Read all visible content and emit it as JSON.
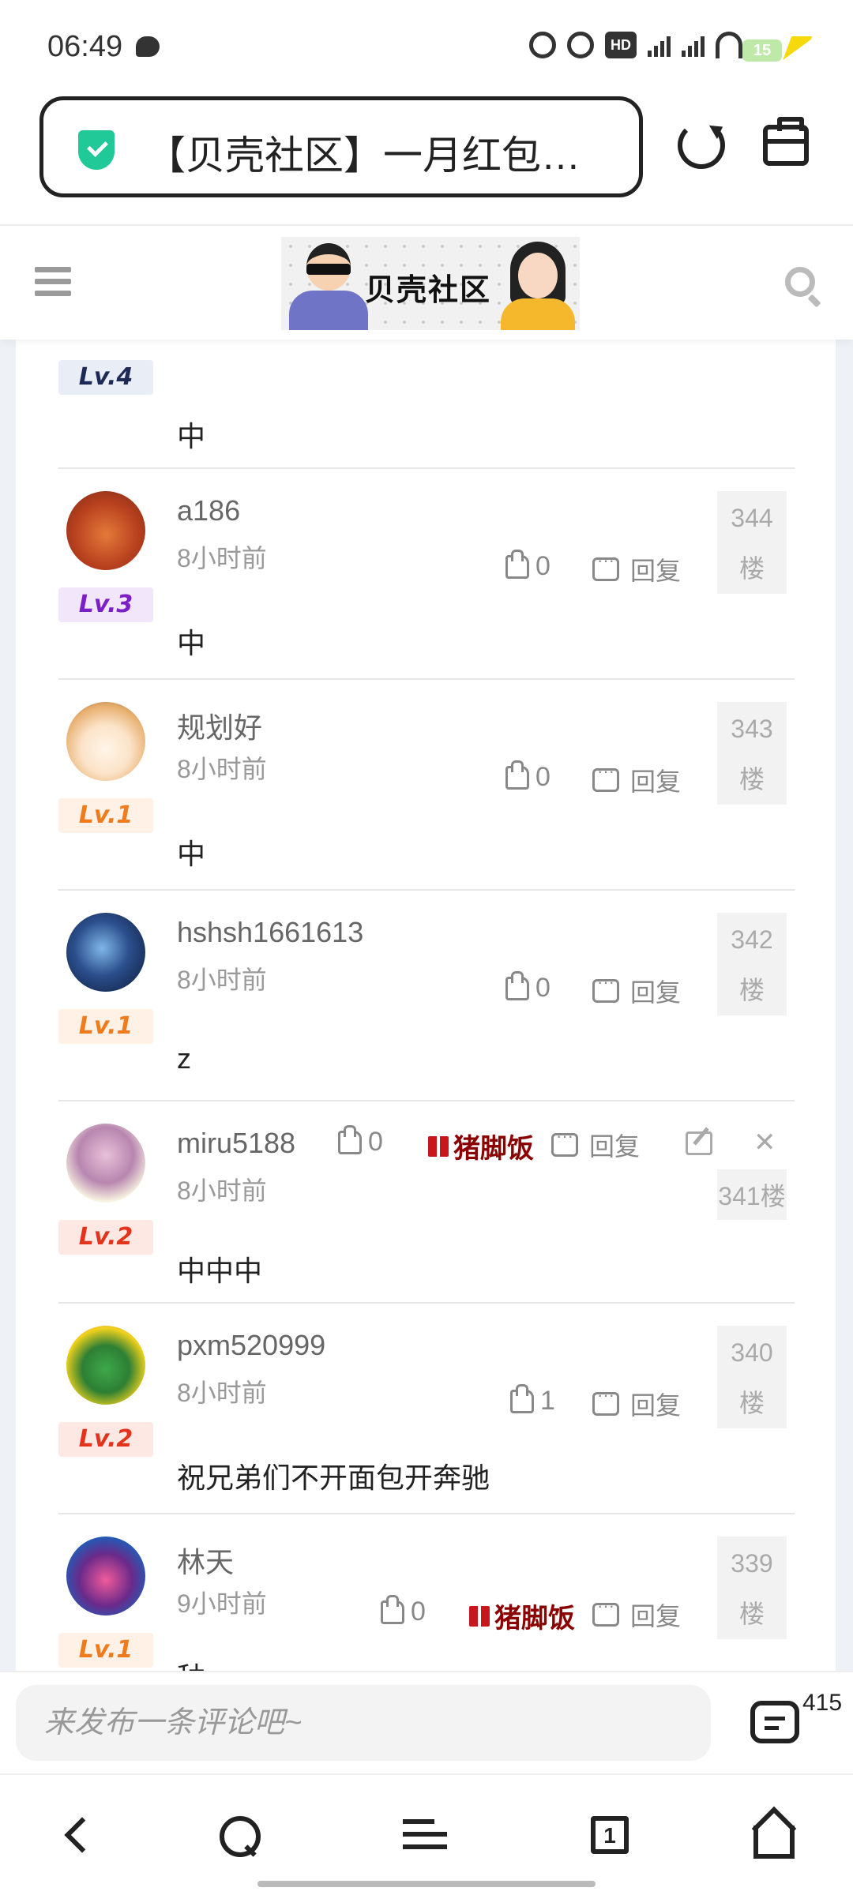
{
  "status_bar": {
    "time": "06:49",
    "battery": "15"
  },
  "browser": {
    "title": "【贝壳社区】一月红包…"
  },
  "site": {
    "logo_text": "贝壳社区"
  },
  "partial_comment": {
    "level": "Lv.4",
    "text": "中"
  },
  "comments": [
    {
      "user": "a186",
      "time": "8小时前",
      "level": "Lv.3",
      "text": "中",
      "likes": "0",
      "reply": "回复",
      "floor_num": "344",
      "floor_unit": "楼"
    },
    {
      "user": "规划好",
      "time": "8小时前",
      "level": "Lv.1",
      "text": "中",
      "likes": "0",
      "reply": "回复",
      "floor_num": "343",
      "floor_unit": "楼"
    },
    {
      "user": "hshsh1661613",
      "time": "8小时前",
      "level": "Lv.1",
      "text": "z",
      "likes": "0",
      "reply": "回复",
      "floor_num": "342",
      "floor_unit": "楼"
    },
    {
      "user": "miru5188",
      "time": "8小时前",
      "level": "Lv.2",
      "text": "中中中",
      "likes": "0",
      "gift": "猪脚饭",
      "reply": "回复",
      "floor_label": "341楼"
    },
    {
      "user": "pxm520999",
      "time": "8小时前",
      "level": "Lv.2",
      "text": "祝兄弟们不开面包开奔驰",
      "likes": "1",
      "reply": "回复",
      "floor_num": "340",
      "floor_unit": "楼"
    },
    {
      "user": "林天",
      "time": "9小时前",
      "level": "Lv.1",
      "text": "种",
      "likes": "0",
      "gift": "猪脚饭",
      "reply": "回复",
      "floor_num": "339",
      "floor_unit": "楼"
    }
  ],
  "compose": {
    "placeholder": "来发布一条评论吧~",
    "count": "415"
  },
  "bottom_nav": {
    "tab_count": "1"
  },
  "colors": {
    "shield": "#20c997",
    "gift": "#8b0000",
    "lv1": "#f07b1c",
    "lv2": "#e2341c",
    "lv3": "#7b1fc7",
    "lv4": "#1c2a55"
  }
}
